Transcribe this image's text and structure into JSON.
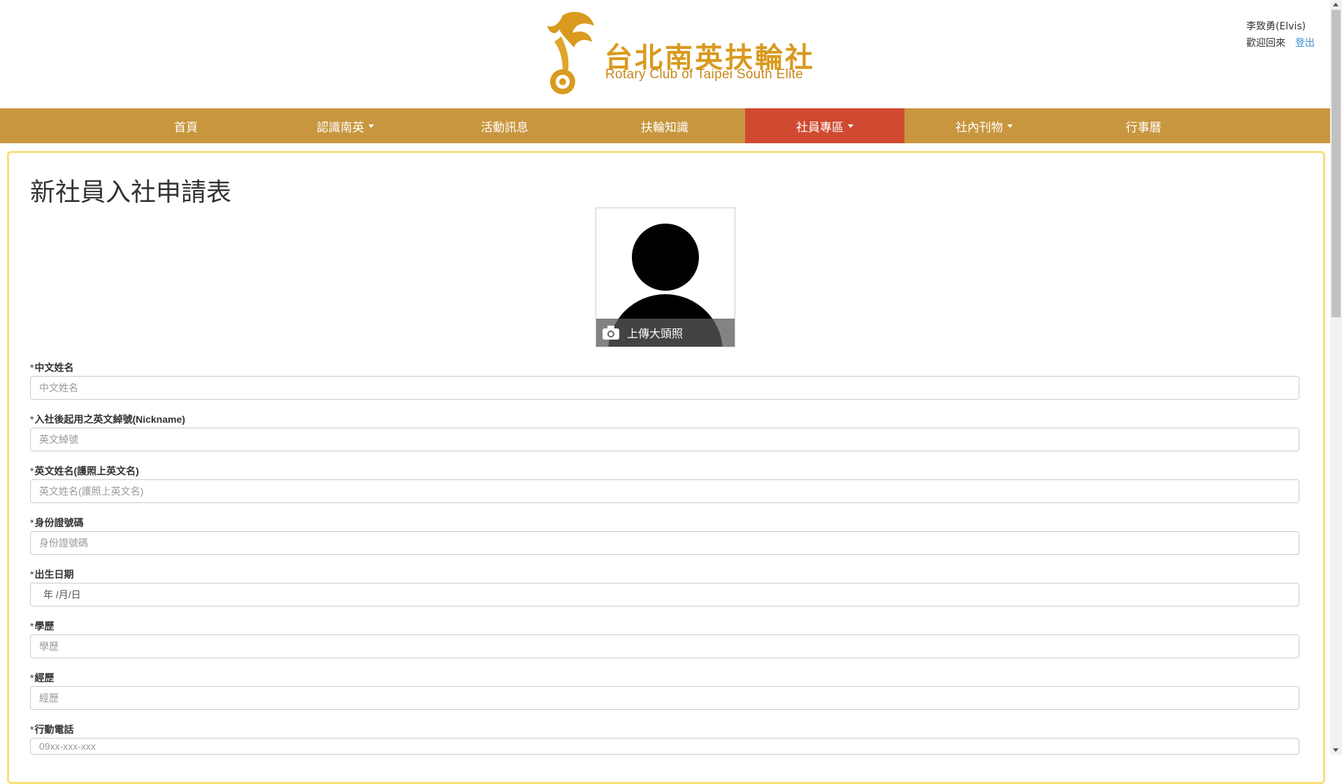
{
  "header": {
    "logo_cn": "台北南英扶輪社",
    "logo_en": "Rotary Club of Taipei South Elite",
    "user_name": "李致勇(Elvis)",
    "welcome": "歡迎回來",
    "logout": "登出"
  },
  "nav": [
    {
      "label": "首頁",
      "dropdown": false
    },
    {
      "label": "認識南英",
      "dropdown": true
    },
    {
      "label": "活動訊息",
      "dropdown": false
    },
    {
      "label": "扶輪知識",
      "dropdown": false
    },
    {
      "label": "社員專區",
      "dropdown": true,
      "active": true
    },
    {
      "label": "社內刊物",
      "dropdown": true
    },
    {
      "label": "行事曆",
      "dropdown": false
    }
  ],
  "page": {
    "title": "新社員入社申請表",
    "upload_label": "上傳大頭照"
  },
  "form": {
    "required_mark": "*",
    "fields": [
      {
        "label": "中文姓名",
        "placeholder": "中文姓名"
      },
      {
        "label": "入社後起用之英文綽號(Nickname)",
        "placeholder": "英文綽號"
      },
      {
        "label": "英文姓名(護照上英文名)",
        "placeholder": "英文姓名(護照上英文名)"
      },
      {
        "label": "身份證號碼",
        "placeholder": "身份證號碼"
      },
      {
        "label": "出生日期",
        "value": "年 /月/日"
      },
      {
        "label": "學歷",
        "placeholder": "學歷"
      },
      {
        "label": "經歷",
        "placeholder": "經歷"
      },
      {
        "label": "行動電話",
        "placeholder": "09xx-xxx-xxx"
      }
    ]
  },
  "colors": {
    "nav_bg": "#c8963e",
    "nav_active": "#d04a31",
    "card_border": "#f6e07a",
    "logo_gold": "#d99a1f"
  }
}
